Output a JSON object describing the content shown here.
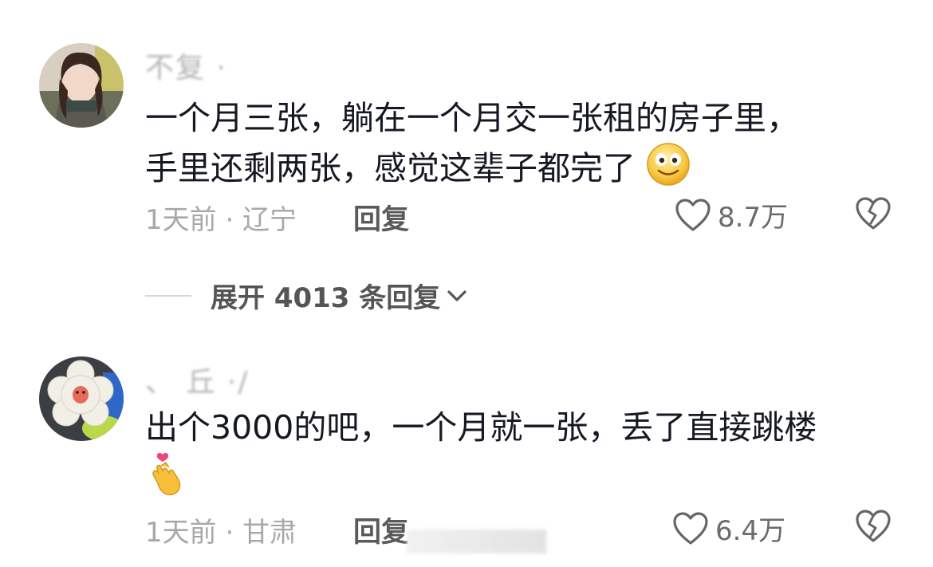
{
  "comments": [
    {
      "username": "不复  ·  ",
      "text_line1": "一个月三张，躺在一个月交一张租的房子里，",
      "text_line2": "手里还剩两张，感觉这辈子都完了",
      "emoji": "smile-emoji",
      "time_location": "1天前 · 辽宁",
      "reply_label": "回复",
      "like_count": "8.7万"
    },
    {
      "username": "、 丘 ·/",
      "text_line1": "出个3000的吧，一个月就一张，丢了直接跳楼",
      "emoji": "finger-heart-emoji",
      "time_location": "1天前 · 甘肃",
      "reply_label": "回复",
      "like_count": "6.4万"
    }
  ],
  "expand_replies": {
    "label": "展开 4013 条回复"
  },
  "colors": {
    "text": "#161823",
    "meta": "#a8a8a8",
    "reply": "#5a5a5a",
    "icon": "#666666"
  }
}
